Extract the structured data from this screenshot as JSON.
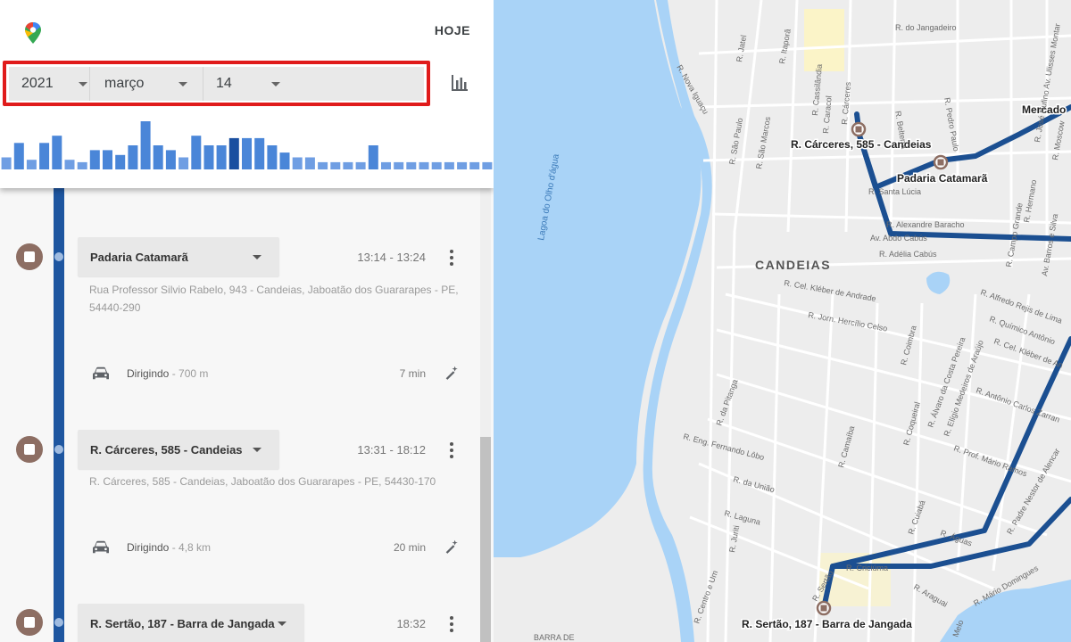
{
  "header": {
    "today_label": "HOJE",
    "date": {
      "year": "2021",
      "month": "março",
      "day": "14"
    },
    "histogram": [
      0.25,
      0.55,
      0.2,
      0.55,
      0.7,
      0.2,
      0.15,
      0.4,
      0.4,
      0.3,
      0.5,
      1.0,
      0.5,
      0.4,
      0.25,
      0.7,
      0.5,
      0.5,
      0.65,
      0.65,
      0.65,
      0.5,
      0.35,
      0.25,
      0.25,
      0.15,
      0.15,
      0.15,
      0.15,
      0.5,
      0.15,
      0.15,
      0.15,
      0.15,
      0.15,
      0.15,
      0.15,
      0.15,
      0.15
    ],
    "histogram_selected_index": 18
  },
  "timeline": {
    "stops": [
      {
        "name": "Padaria Catamarã",
        "time": "13:14 - 13:24",
        "address_line1": "Rua Professor Silvio Rabelo, 943 - Candeias, Jaboatão dos Guararapes - PE,",
        "address_line2": "54440-290",
        "mode": "Dirigindo",
        "distance": " - 700 m",
        "duration": "7 min"
      },
      {
        "name": "R. Cárceres, 585 - Candeias",
        "time": "13:31 - 18:12",
        "address_line1": "R. Cárceres, 585 - Candeias, Jaboatão dos Guararapes - PE, 54430-170",
        "address_line2": "",
        "mode": "Dirigindo",
        "distance": " - 4,8 km",
        "duration": "20 min"
      },
      {
        "name": "R. Sertão, 187 - Barra de Jangada",
        "time": "18:32"
      }
    ]
  },
  "map": {
    "neighborhood": "CANDEIAS",
    "water_label": "Lagoa do Olho d'água",
    "pins": [
      "R. Cárceres, 585 - Candeias",
      "Padaria Catamarã",
      "R. Sertão, 187 - Barra de Jangada",
      "Mercado"
    ],
    "streets": [
      "R. do Jangadeiro",
      "R. Jatel",
      "R. Itaporã",
      "R. Pedro Paulo",
      "R. Nova Iguaçu",
      "R. Cárceres",
      "R. Caracol",
      "R. Cassilândia",
      "R. São Paulo",
      "R. São Marcos",
      "R. Belterra",
      "R. Santa Lúcia",
      "R. Alexandre Baracho",
      "Av. Abdo Cabús",
      "R. Adélia Cabús",
      "R. Cel. Kléber de Andrade",
      "R. Jorn. Hercílio Celso",
      "R. Coimbra",
      "R. Alfredo Rejis de Lima",
      "R. Químico Antônio",
      "R. Cel. Kléber de An",
      "R. Antônio Carlos Zarran",
      "R. da Pitanga",
      "R. Eng. Fernando Lôbo",
      "R. da União",
      "R. Laguna",
      "R. Camaíba",
      "R. Coqueiral",
      "R. Álvaro da Costa Pereira",
      "R. Elígio Medeiros de Araújo",
      "R. Prof. Mário Ramos",
      "R. Padre Nestor de Alencar",
      "R. Cuiabá",
      "R. Águas",
      "R. Juriti",
      "R. Centro e Um",
      "R. Criciúma",
      "R. Araguai",
      "R. Mário Domingues",
      "R. Sertão",
      "R. Campo Grande",
      "R. Hermano",
      "Av. Ulisses Montar",
      "R. José Rufino",
      "R. Moscow",
      "Av. Barros e Silva",
      "BARRA DE",
      "Melo"
    ]
  }
}
